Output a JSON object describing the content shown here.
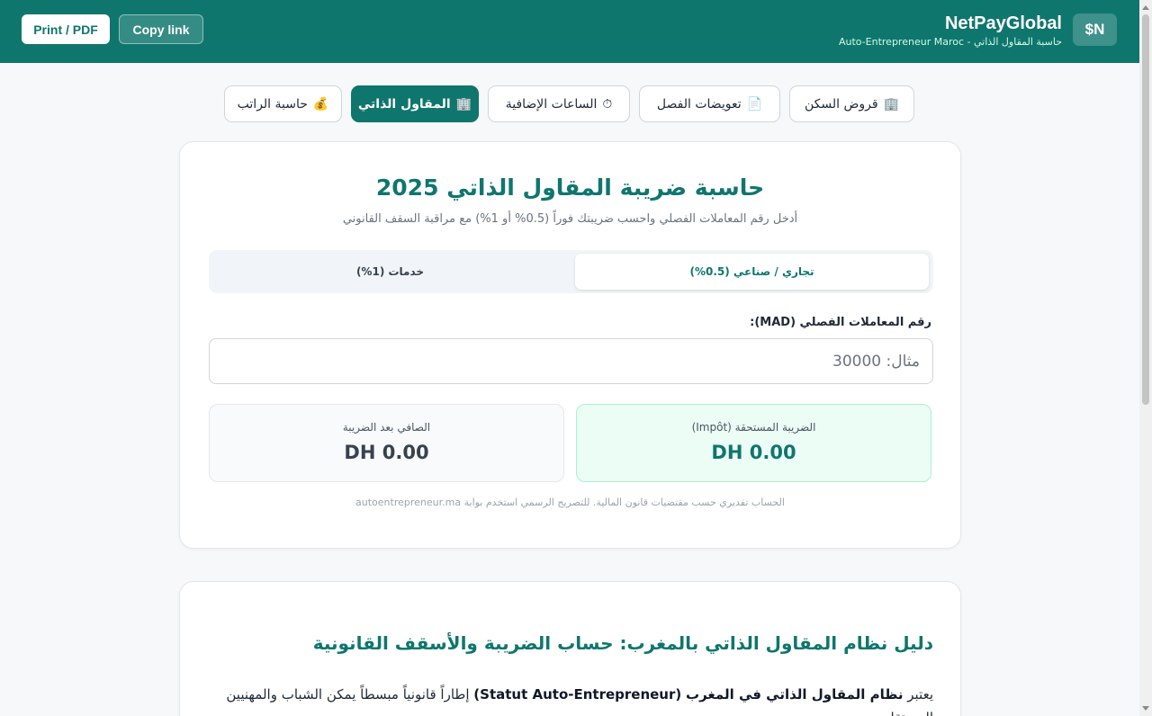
{
  "header": {
    "print_label": "Print / PDF",
    "copy_label": "Copy link",
    "brand": "NetPayGlobal",
    "subtitle": "حاسبة المقاول الذاتي - Auto-Entrepreneur Maroc",
    "logo_text": "$N"
  },
  "tabs": [
    {
      "label": "قروض السكن",
      "icon": "🏢"
    },
    {
      "label": "تعويضات الفصل",
      "icon": "📄"
    },
    {
      "label": "الساعات الإضافية",
      "icon": "⏱"
    },
    {
      "label": "المقاول الذاتي",
      "icon": "🏢"
    },
    {
      "label": "حاسبة الراتب",
      "icon": "💰"
    }
  ],
  "calculator": {
    "title": "حاسبة ضريبة المقاول الذاتي 2025",
    "subtitle": "أدخل رقم المعاملات الفصلي واحسب ضريبتك فوراً (0.5% أو 1%) مع مراقبة السقف القانوني",
    "segment_commercial": "تجاري / صناعي (0.5%)",
    "segment_services": "خدمات (1%)",
    "field_label": "رقم المعاملات الفصلي (MAD):",
    "field_placeholder": "مثال: 30000",
    "tax_label": "الضريبة المستحقة (Impôt)",
    "tax_value": "DH 0.00",
    "net_label": "الصافي بعد الضريبة",
    "net_value": "DH 0.00",
    "disclaimer": "الحساب تقديري حسب مقتضيات قانون المالية. للتصريح الرسمي استخدم بوابة autoentrepreneur.ma"
  },
  "guide": {
    "title": "دليل نظام المقاول الذاتي بالمغرب: حساب الضريبة والأسقف القانونية",
    "para_prefix": "يعتبر ",
    "para_bold1": "نظام المقاول الذاتي في المغرب",
    "para_bold2": "(Statut Auto-Entrepreneur)",
    "para_rest": " إطاراً قانونياً مبسطاً يمكن الشباب والمهنيين المستقلين"
  },
  "colors": {
    "primary": "#0f766e",
    "tax_box": "#ecfdf5",
    "background": "#f6f8fa"
  }
}
